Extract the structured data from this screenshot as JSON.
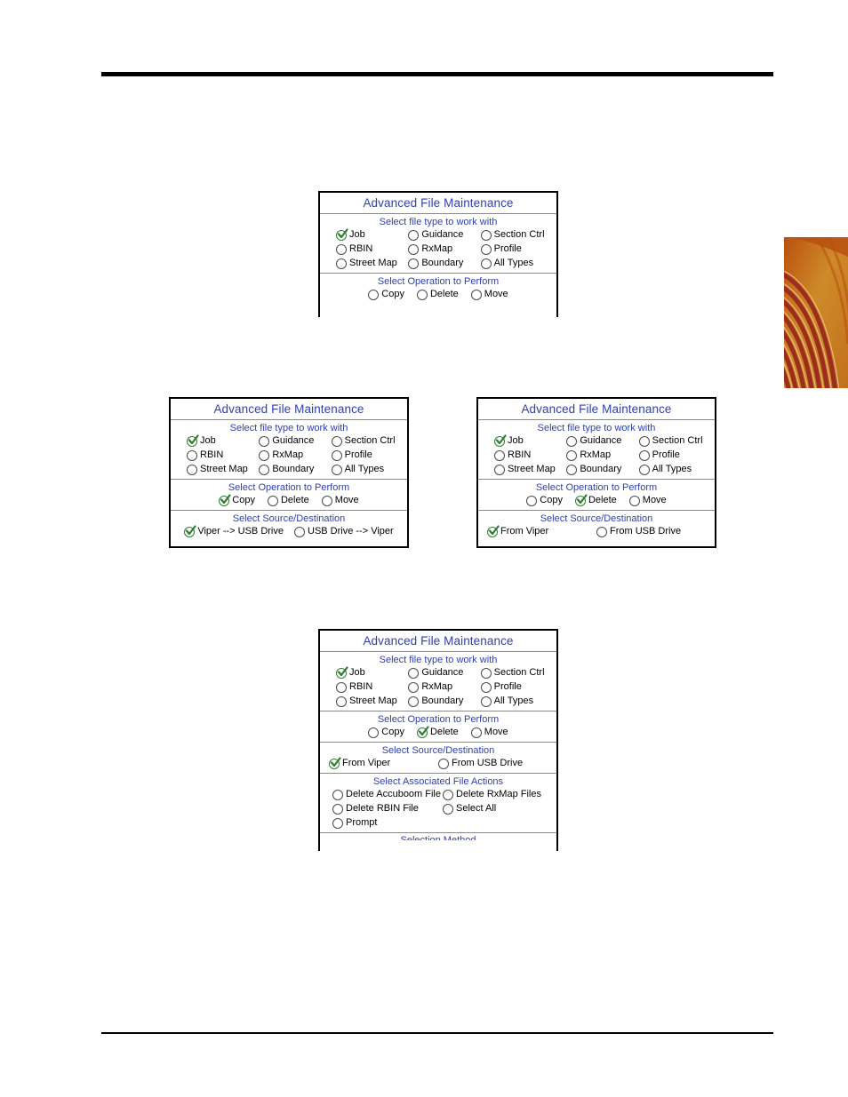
{
  "page": {
    "background": "#ffffff",
    "rule_color": "#000000",
    "title_color": "#2f3faf",
    "heading_color": "#2f3faf",
    "check_color": "#2f7d32"
  },
  "decoration": {
    "name": "orange-swirl-graphic",
    "colors": {
      "background": "#c8741a",
      "band_dark": "#9c2d1c",
      "band_mid": "#c05a22",
      "line_light": "#e6c48a"
    }
  },
  "labels": {
    "dialog_title": "Advanced File Maintenance",
    "head_file_type": "Select file type to work with",
    "head_operation": "Select Operation to Perform",
    "head_source_dest": "Select Source/Destination",
    "head_assoc_actions": "Select Associated File Actions",
    "head_selection_method": "Selection Method",
    "file_types": [
      "Job",
      "Guidance",
      "Section Ctrl",
      "RBIN",
      "RxMap",
      "Profile",
      "Street Map",
      "Boundary",
      "All Types"
    ],
    "operations": [
      "Copy",
      "Delete",
      "Move"
    ],
    "source_dest_copy": [
      "Viper --> USB Drive",
      "USB Drive --> Viper"
    ],
    "source_dest_delete": [
      "From Viper",
      "From USB Drive"
    ],
    "assoc_actions": [
      "Delete Accuboom File",
      "Delete RxMap Files",
      "Delete RBIN File",
      "Select All",
      "Prompt"
    ]
  },
  "panels": {
    "top": {
      "title": "Advanced File Maintenance",
      "file_type_selected": 0,
      "operation_selected": -1,
      "sections": [
        "file_type",
        "operation"
      ]
    },
    "left": {
      "title": "Advanced File Maintenance",
      "file_type_selected": 0,
      "operation_selected": 0,
      "source_dest_selected": 0,
      "source_dest_mode": "copy"
    },
    "right": {
      "title": "Advanced File Maintenance",
      "file_type_selected": 0,
      "operation_selected": 1,
      "source_dest_selected": 0,
      "source_dest_mode": "delete"
    },
    "bottom": {
      "title": "Advanced File Maintenance",
      "file_type_selected": 0,
      "operation_selected": 1,
      "source_dest_selected": 0,
      "source_dest_mode": "delete",
      "assoc_selected": -1,
      "clipped_heading": "Selection Method"
    }
  }
}
